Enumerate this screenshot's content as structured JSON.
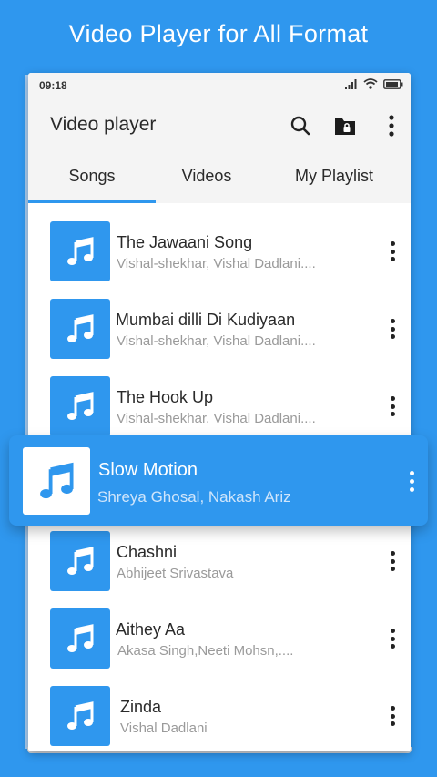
{
  "promo": {
    "headline": "Video Player for All Format"
  },
  "status_bar": {
    "time": "09:18"
  },
  "app_bar": {
    "title": "Video player",
    "actions": [
      "search-icon",
      "lock-folder-icon",
      "more-vert-icon"
    ]
  },
  "tabs": [
    {
      "label": "Songs",
      "selected": true
    },
    {
      "label": "Videos",
      "selected": false
    },
    {
      "label": "My Playlist",
      "selected": false
    }
  ],
  "songs": [
    {
      "title": "The Jawaani Song",
      "artist": "Vishal-shekhar, Vishal Dadlani...."
    },
    {
      "title": "Mumbai dilli Di Kudiyaan",
      "artist": "Vishal-shekhar, Vishal Dadlani...."
    },
    {
      "title": "The Hook Up",
      "artist": "Vishal-shekhar, Vishal Dadlani...."
    },
    {
      "title": "Chashni",
      "artist": "Abhijeet Srivastava"
    },
    {
      "title": "Aithey Aa",
      "artist": "Akasa Singh,Neeti Mohsn,...."
    },
    {
      "title": "Zinda",
      "artist": "Vishal Dadlani"
    }
  ],
  "highlighted_song": {
    "title": "Slow Motion",
    "artist": "Shreya Ghosal, Nakash Ariz"
  },
  "colors": {
    "accent": "#2f97ee",
    "background": "#2f97ee",
    "appbar": "#f4f4f4"
  }
}
